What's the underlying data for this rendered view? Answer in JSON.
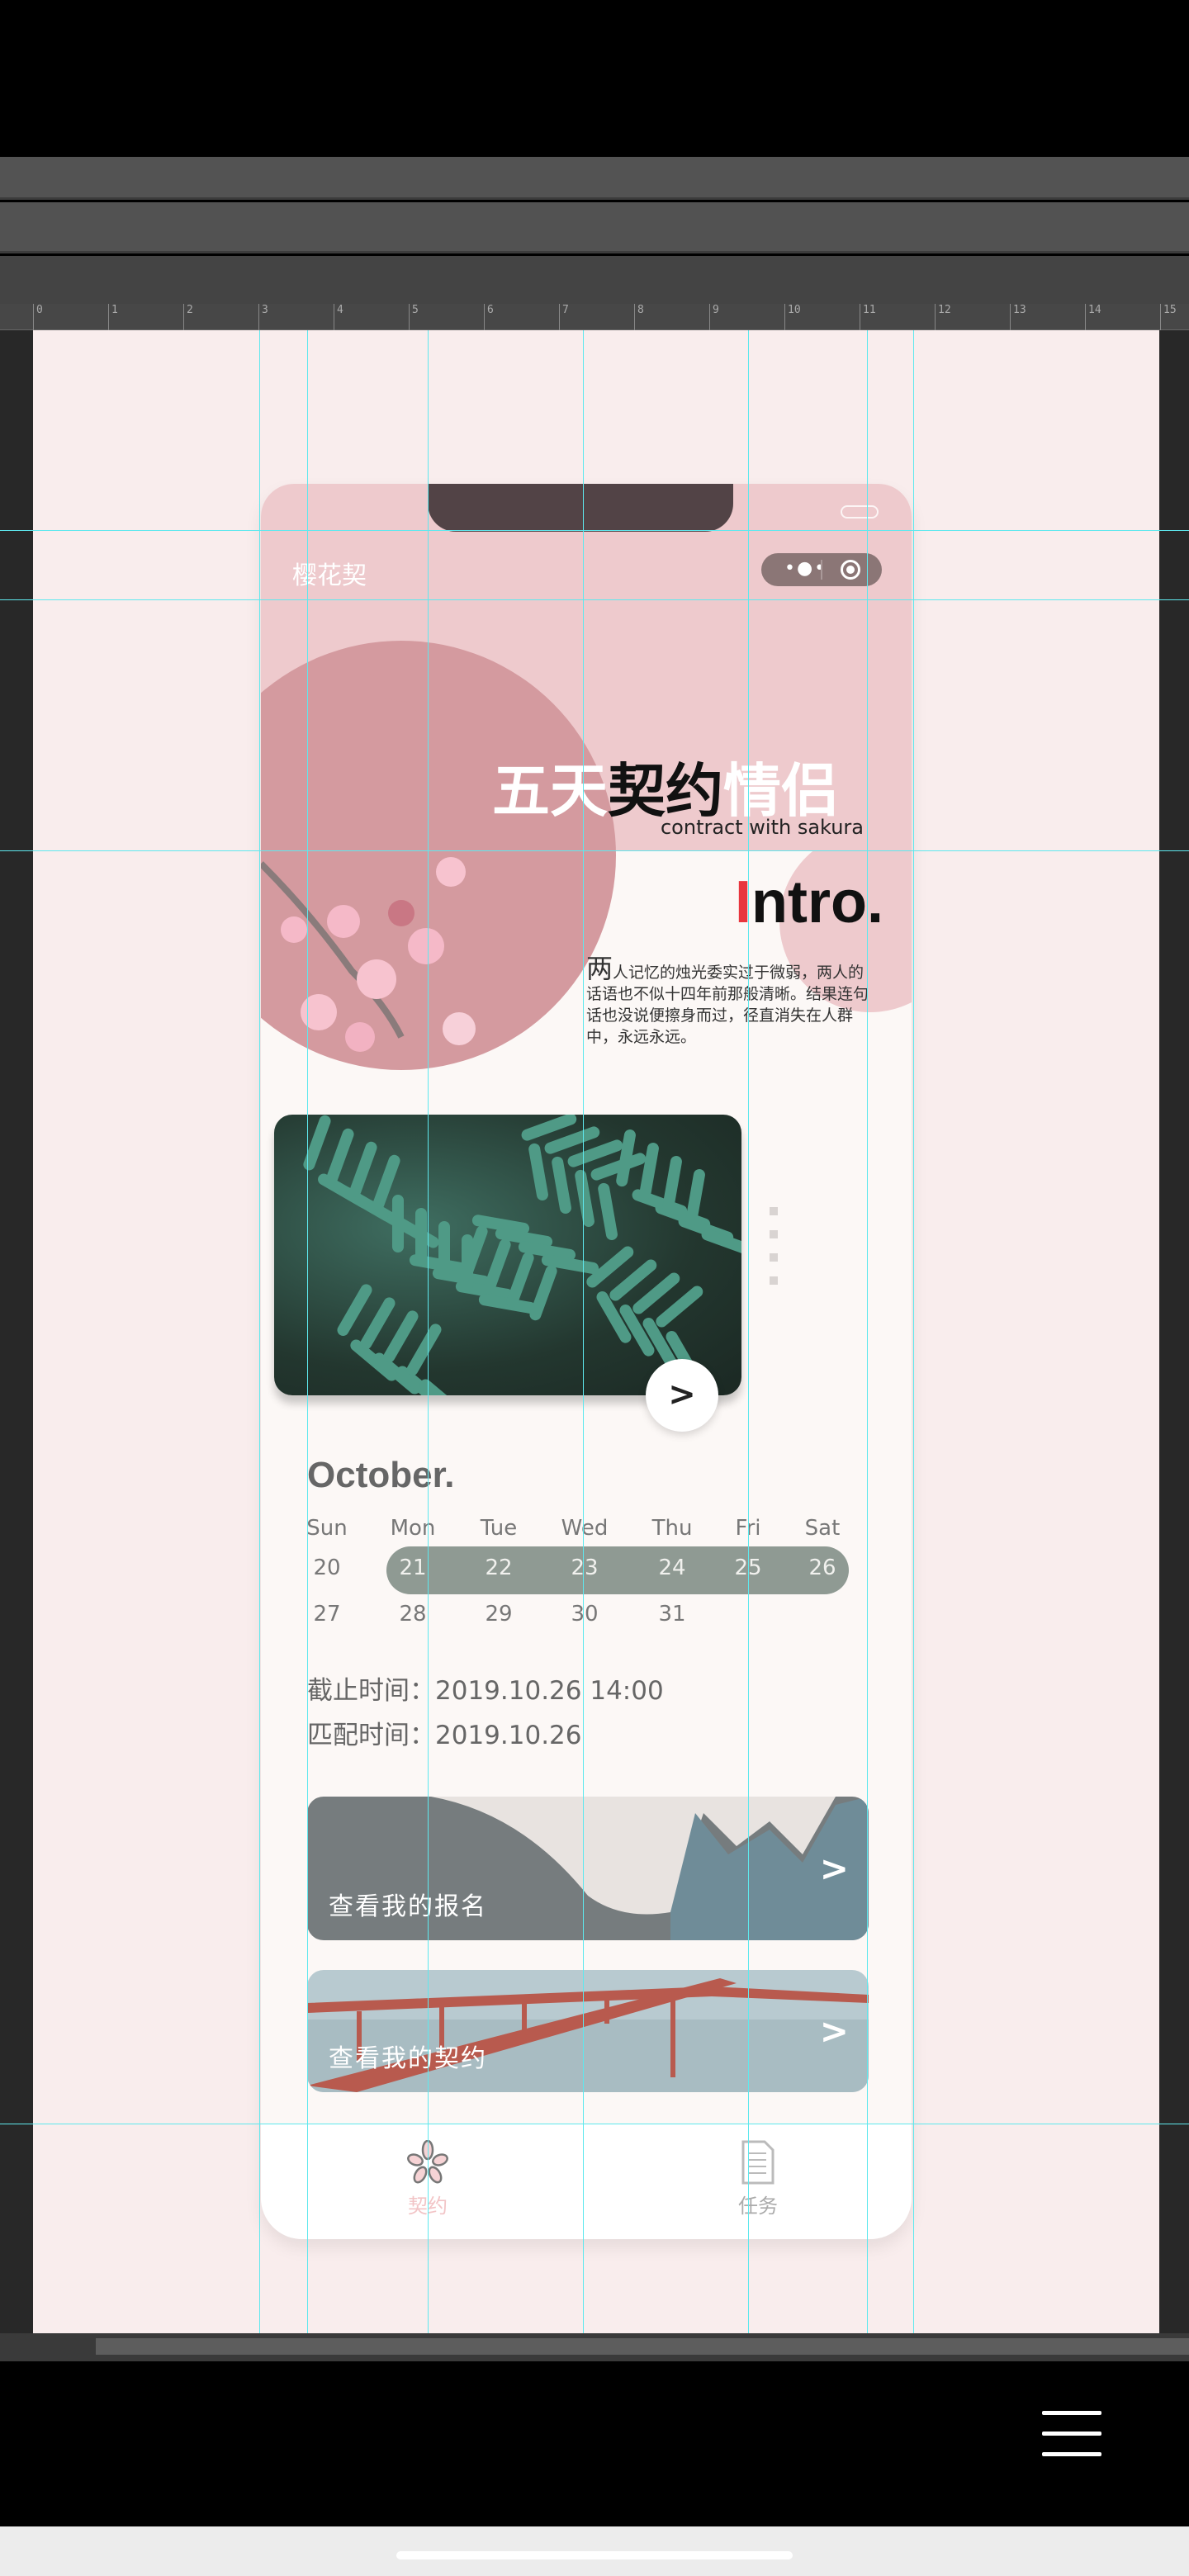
{
  "ruler": {
    "ticks": [
      "0",
      "1",
      "2",
      "3",
      "4",
      "5",
      "6",
      "7",
      "8",
      "9",
      "10",
      "11",
      "12",
      "13",
      "14",
      "15"
    ]
  },
  "app": {
    "title": "樱花契",
    "capsule_menu_icon": "more-dots-icon",
    "capsule_close_icon": "target-circle-icon"
  },
  "hero": {
    "slogan_part1": "五天",
    "slogan_part2": "契约",
    "slogan_part3": "情侣",
    "subtitle": "contract with sakura"
  },
  "intro": {
    "heading_first": "I",
    "heading_rest": "ntro.",
    "first_char": "两",
    "text": "人记忆的烛光委实过于微弱，两人的话语也不似十四年前那般清晰。结果连句话也没说便擦身而过，径直消失在人群中，永远永远。"
  },
  "gallery": {
    "next_label": ">"
  },
  "calendar": {
    "month": "October.",
    "weekdays": [
      "Sun",
      "Mon",
      "Tue",
      "Wed",
      "Thu",
      "Fri",
      "Sat"
    ],
    "rows": [
      [
        "20",
        "21",
        "22",
        "23",
        "24",
        "25",
        "26"
      ],
      [
        "27",
        "28",
        "29",
        "30",
        "31",
        "",
        ""
      ]
    ],
    "selected_range": [
      "21",
      "26"
    ],
    "accent": "#8f9a93"
  },
  "info": {
    "deadline_label": "截止时间：",
    "deadline_value": "2019.10.26  14:00",
    "match_label": "匹配时间：",
    "match_value": "2019.10.26"
  },
  "cards": [
    {
      "label": "查看我的报名",
      "arrow": ">"
    },
    {
      "label": "查看我的契约",
      "arrow": ">"
    }
  ],
  "tabs": [
    {
      "label": "契约",
      "icon": "sakura-flower-icon",
      "active": true,
      "color": "#f2c4c6"
    },
    {
      "label": "任务",
      "icon": "document-icon",
      "active": false,
      "color": "#aaaaaa"
    }
  ]
}
